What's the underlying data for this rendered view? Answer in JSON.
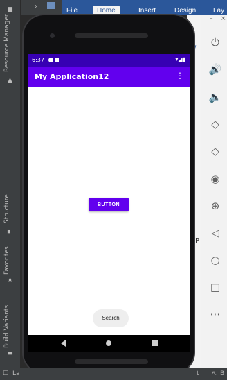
{
  "ide": {
    "left_tabs": {
      "resource_manager": "Resource Manager",
      "structure": "Structure",
      "favorites": "Favorites",
      "build_variants": "Build Variants"
    },
    "bottom_bar": {
      "left_label": "La",
      "right_tab_fragment": "t",
      "right_tab_label": "B"
    }
  },
  "ribbon": {
    "tabs": [
      "File",
      "Home",
      "Insert",
      "Design",
      "Lay"
    ]
  },
  "phone": {
    "status": {
      "time": "6:37"
    },
    "app_title": "My Application12",
    "menu_icon": "more-vert-icon",
    "button_label": "BUTTON",
    "search_label": "Search",
    "nav": {
      "back": "back-icon",
      "home": "home-icon",
      "recent": "recents-icon"
    }
  },
  "emulator_toolbar": {
    "window_controls": [
      "–",
      "×"
    ],
    "buttons": [
      {
        "name": "power-icon",
        "glyph": "⏻"
      },
      {
        "name": "volume-up-icon",
        "glyph": "🔊"
      },
      {
        "name": "volume-down-icon",
        "glyph": "🔈"
      },
      {
        "name": "rotate-left-icon",
        "glyph": "◇"
      },
      {
        "name": "rotate-right-icon",
        "glyph": "◇"
      },
      {
        "name": "camera-icon",
        "glyph": "◉"
      },
      {
        "name": "zoom-icon",
        "glyph": "⊕"
      },
      {
        "name": "back-nav-icon",
        "glyph": "◁"
      },
      {
        "name": "home-nav-icon",
        "glyph": "○"
      },
      {
        "name": "overview-nav-icon",
        "glyph": "□"
      },
      {
        "name": "more-icon",
        "glyph": "⋯"
      }
    ]
  },
  "colors": {
    "primary": "#6200ee",
    "primary_dark": "#3700b3",
    "ribbon": "#2b579a",
    "ide_bg": "#3c3f41"
  }
}
